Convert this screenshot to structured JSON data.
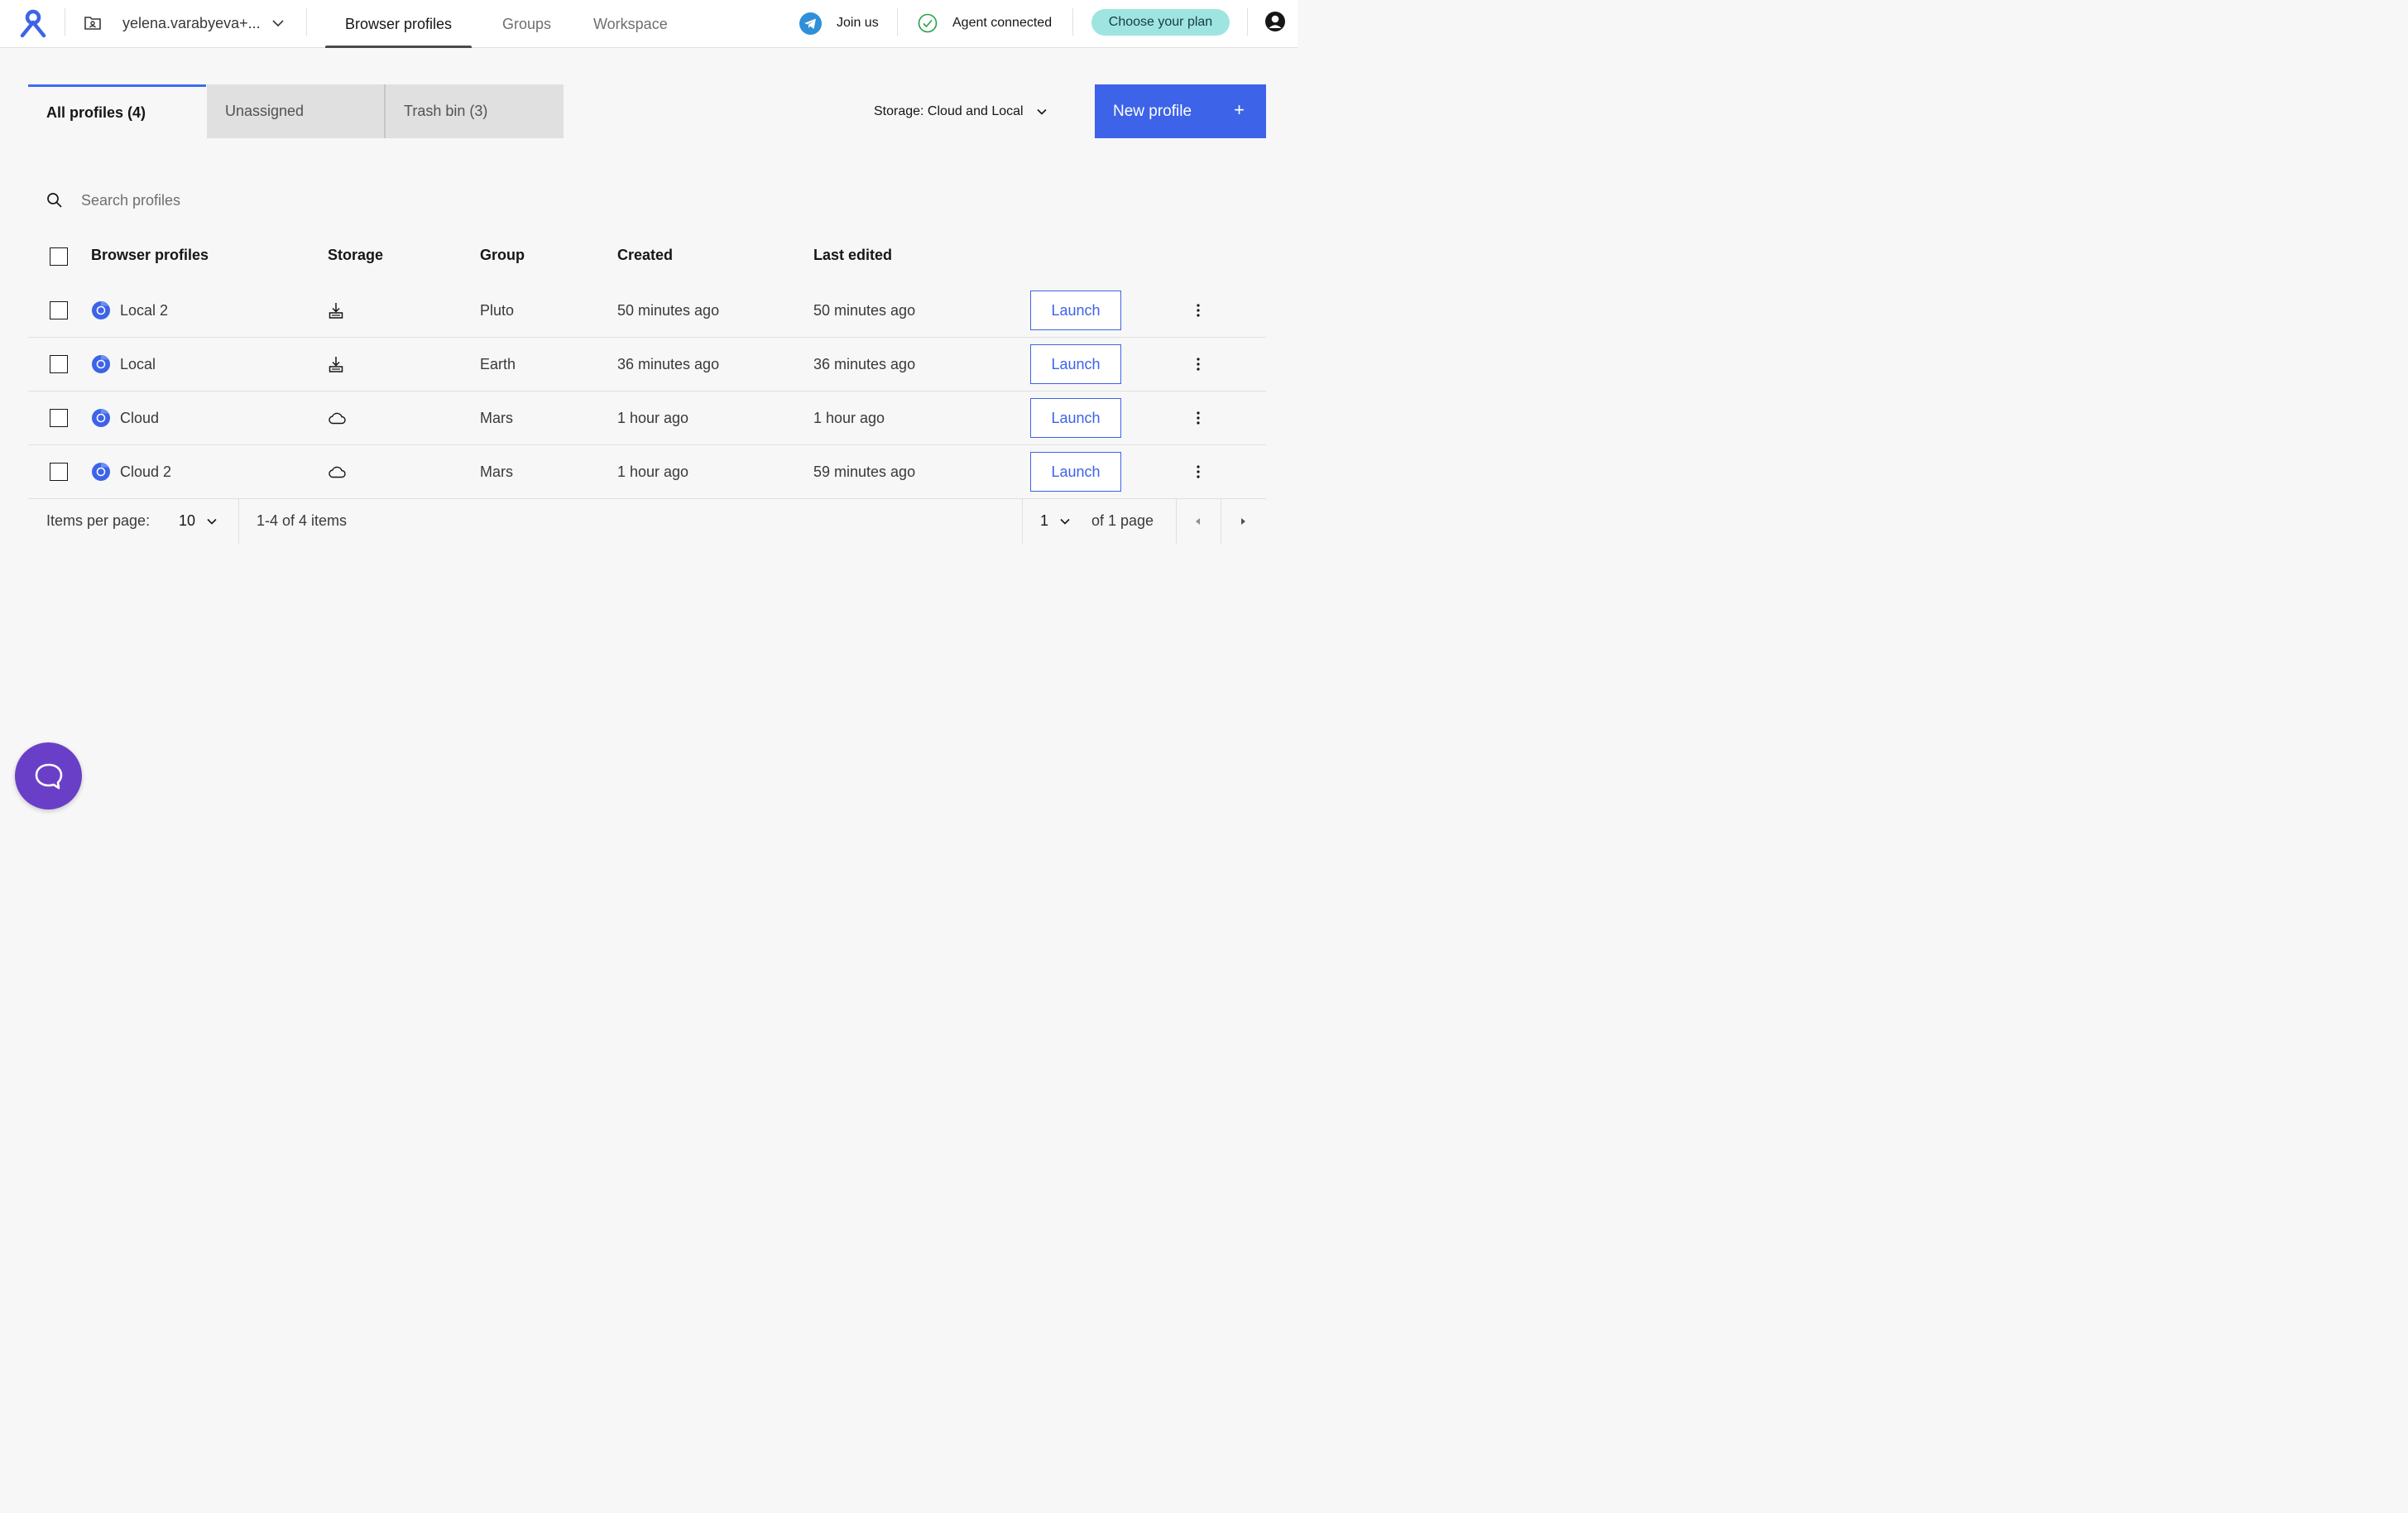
{
  "header": {
    "workspace_name": "yelena.varabyeva+...",
    "nav_tabs": [
      {
        "label": "Browser profiles",
        "active": true
      },
      {
        "label": "Groups",
        "active": false
      },
      {
        "label": "Workspace",
        "active": false
      }
    ],
    "join_label": "Join us",
    "agent_status": "Agent connected",
    "plan_button": "Choose your plan"
  },
  "tabs": [
    {
      "label": "All profiles (4)",
      "active": true
    },
    {
      "label": "Unassigned",
      "active": false
    },
    {
      "label": "Trash bin (3)",
      "active": false
    }
  ],
  "storage_filter": "Storage: Cloud and Local",
  "new_profile_button": "New profile",
  "new_profile_icon": "+",
  "search": {
    "placeholder": "Search profiles",
    "value": ""
  },
  "table": {
    "columns": [
      "Browser profiles",
      "Storage",
      "Group",
      "Created",
      "Last edited"
    ],
    "rows": [
      {
        "name": "Local 2",
        "storage": "local-storage-icon",
        "group": "Pluto",
        "created": "50 minutes ago",
        "edited": "50 minutes ago",
        "action": "Launch"
      },
      {
        "name": "Local",
        "storage": "local-storage-icon",
        "group": "Earth",
        "created": "36 minutes ago",
        "edited": "36 minutes ago",
        "action": "Launch"
      },
      {
        "name": "Cloud",
        "storage": "cloud-icon",
        "group": "Mars",
        "created": "1 hour ago",
        "edited": "1 hour ago",
        "action": "Launch"
      },
      {
        "name": "Cloud 2",
        "storage": "cloud-icon",
        "group": "Mars",
        "created": "1 hour ago",
        "edited": "59 minutes ago",
        "action": "Launch"
      }
    ]
  },
  "pagination": {
    "items_per_page_label": "Items per page:",
    "items_per_page": "10",
    "range": "1-4 of 4 items",
    "page": "1",
    "of_pages": "of 1 page"
  },
  "colors": {
    "accent": "#3d63e8",
    "plan_button_bg": "#9ee5e1",
    "chat_bubble": "#6a3fc8",
    "agent_ok": "#24a148",
    "telegram": "#2f8fd8"
  }
}
